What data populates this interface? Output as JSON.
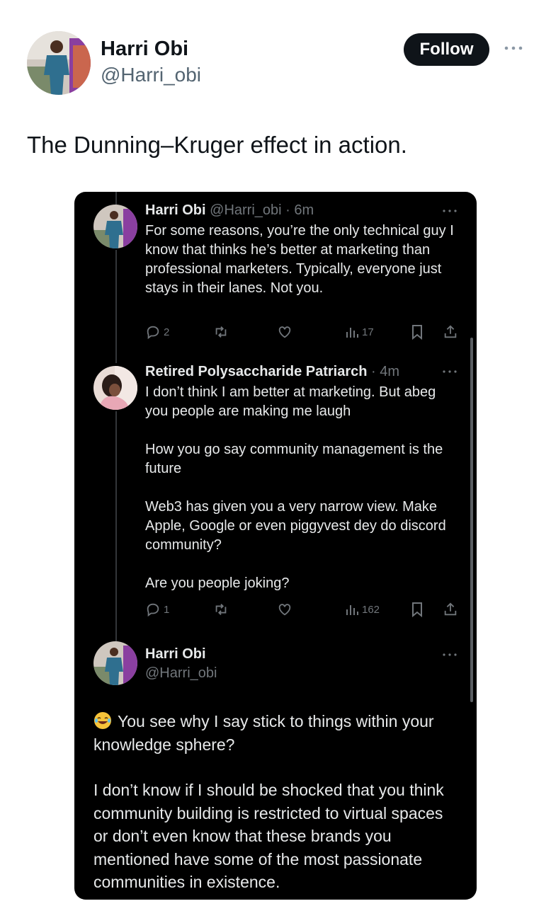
{
  "post": {
    "author_name": "Harri Obi",
    "author_handle": "@Harri_obi",
    "follow_label": "Follow",
    "text": "The Dunning–Kruger effect in action."
  },
  "screenshot": {
    "tweet1": {
      "name": "Harri Obi",
      "meta": "@Harri_obi · 6m",
      "body": "For some reasons, you’re the only technical guy I know that thinks he’s better at marketing than professional marketers. Typically, everyone just stays in their lanes. Not you.",
      "replies": "2",
      "views": "17"
    },
    "tweet2": {
      "name": "Retired Polysaccharide Patriarch",
      "meta": "· 4m",
      "paragraphs": [
        "I don’t think I am better at marketing. But abeg you people are making me laugh",
        "How you go say community management is the future",
        "Web3 has given you a very narrow view. Make Apple, Google or even piggyvest dey do discord community?",
        "Are you people joking?"
      ],
      "replies": "1",
      "views": "162"
    },
    "tweet3": {
      "name": "Harri Obi",
      "handle": "@Harri_obi",
      "paragraph1": "You see why I say stick to things within your knowledge sphere?",
      "paragraph2": "I don’t know if I should be shocked that you think community building is restricted to virtual spaces or don’t even know that these brands you mentioned have some of the most passionate communities in existence."
    }
  },
  "colors": {
    "accent_dark": "#0f1419",
    "secondary_text": "#536471",
    "shot_background": "#000000",
    "shot_text": "#e7e9ea",
    "shot_meta": "#71767b"
  },
  "icons": [
    "more-icon",
    "reply-icon",
    "retweet-icon",
    "like-icon",
    "views-icon",
    "bookmark-icon",
    "share-icon",
    "laughing-emoji-icon"
  ]
}
